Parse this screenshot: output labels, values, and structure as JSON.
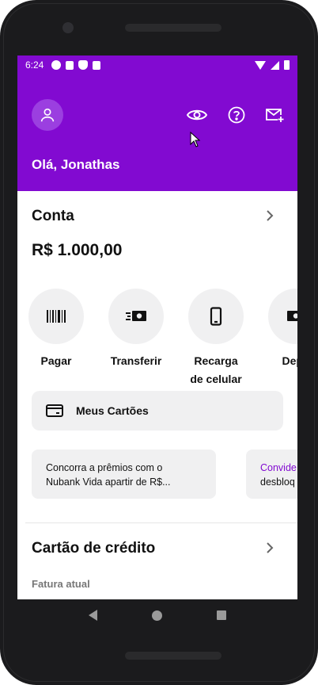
{
  "status_bar": {
    "time": "6:24",
    "left_icons": [
      "a-badge-icon",
      "a-square-icon",
      "shield-icon",
      "sd-card-icon"
    ],
    "right_icons": [
      "wifi-icon",
      "signal-icon",
      "battery-icon"
    ]
  },
  "header": {
    "greeting": "Olá, Jonathas",
    "icons": [
      "avatar-icon",
      "eye-icon",
      "help-icon",
      "mail-add-icon"
    ]
  },
  "account": {
    "title": "Conta",
    "balance": "R$ 1.000,00"
  },
  "actions": [
    {
      "label": "Pagar",
      "icon": "barcode-icon"
    },
    {
      "label": "Transferir",
      "icon": "cash-transfer-icon"
    },
    {
      "label": "Recarga",
      "label2": "de celular",
      "icon": "phone-icon"
    },
    {
      "label": "Depo",
      "icon": "deposit-icon"
    }
  ],
  "cards_button": {
    "label": "Meus Cartões",
    "icon": "card-icon"
  },
  "promos": [
    {
      "line1": "Concorra a prêmios com o",
      "line2": "Nubank Vida apartir de R$..."
    },
    {
      "line1": "Convide",
      "line2": "desbloq"
    }
  ],
  "credit": {
    "title": "Cartão de crédito",
    "subtitle": "Fatura atual"
  },
  "colors": {
    "brand": "#820ad1",
    "surface": "#f0f0f1",
    "text": "#111111",
    "muted": "#777777"
  }
}
